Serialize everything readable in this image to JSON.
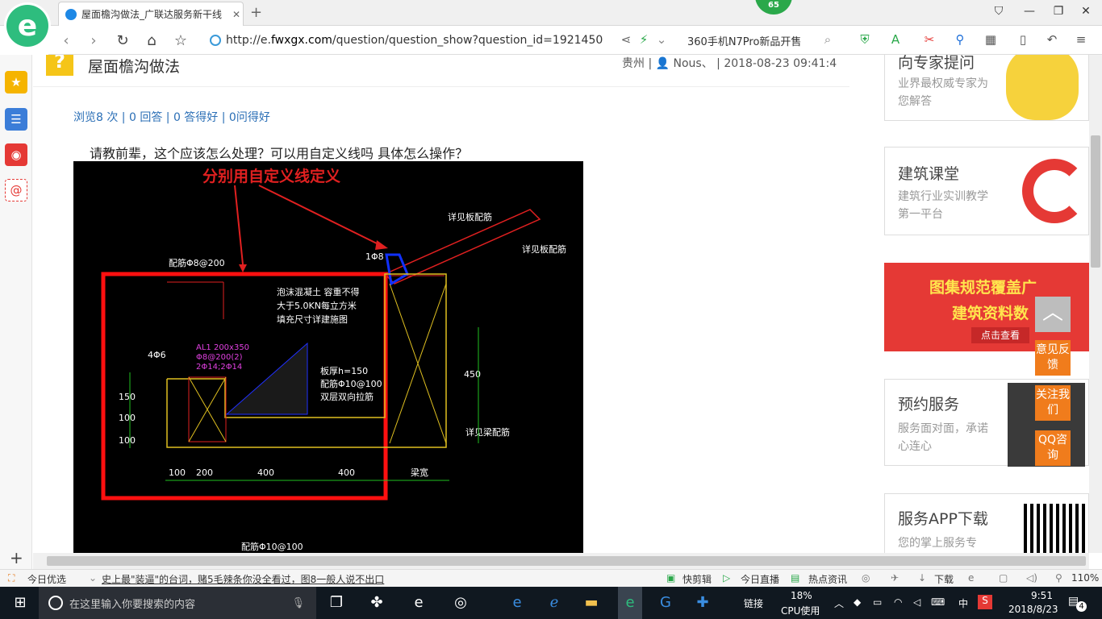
{
  "browser": {
    "tab_title": "屋面檐沟做法_广联达服务新干线",
    "tab_close": "✕",
    "new_tab": "+",
    "badge": "65",
    "url_prefix": "http://e.",
    "url_domain": "fwxgx.com",
    "url_path": "/question/question_show?question_id=1921450",
    "news": "360手机N7Pro新品开售"
  },
  "question": {
    "icon": "?",
    "title": "屋面檐沟做法",
    "meta": "贵州 | 👤 Nous、 | 2018-08-23 09:41:4",
    "stats": "浏览8 次 | 0 回答 | 0 答得好 | 0问得好",
    "body": "请教前辈，这个应该怎么处理？可以用自定义线吗 具体怎么操作？"
  },
  "drawing": {
    "annotation": "分别用自定义线定义",
    "labels": [
      "详见板配筋",
      "详见板配筋",
      "1Φ8",
      "配筋Φ8@200",
      "泡沫混凝土 容重不得",
      "大于5.0KN每立方米",
      "填充尺寸详建施图",
      "4Φ6",
      "AL1 200x350",
      "Φ8@200(2)",
      "2Φ14;2Φ14",
      "板厚h=150",
      "配筋Φ10@100",
      "双层双向拉筋",
      "450",
      "详见梁配筋",
      "150",
      "100",
      "100",
      "100",
      "200",
      "400",
      "400",
      "梁宽",
      "配筋Φ10@100"
    ]
  },
  "sidebar_right": {
    "card1_title": "向专家提问",
    "card1_sub": "业界最权威专家为您解答",
    "card2_title": "建筑课堂",
    "card2_sub": "建筑行业实训教学第一平台",
    "banner_line1": "图集规范覆盖广",
    "banner_line2": "建筑资料数",
    "banner_btn": "点击查看",
    "card3_title": "预约服务",
    "card3_sub": "服务面对面，承诺心连心",
    "card4_title": "服务APP下载",
    "card4_sub": "您的掌上服务专",
    "float1": "意见反馈",
    "float2": "关注我们",
    "float3": "QQ咨询",
    "totop": "︿"
  },
  "statusbar": {
    "left": "今日优选",
    "headline": "史上最\"装逼\"的台词，赌5毛辣条你没全看过，图8一般人说不出口",
    "items": [
      "快剪辑",
      "今日直播",
      "热点资讯",
      "下载"
    ],
    "zoom": "110%"
  },
  "taskbar": {
    "search_placeholder": "在这里输入你要搜索的内容",
    "link": "链接",
    "cpu_pct": "18%",
    "cpu_label": "CPU使用",
    "ime": "中",
    "time": "9:51",
    "date": "2018/8/23",
    "notif": "4"
  }
}
